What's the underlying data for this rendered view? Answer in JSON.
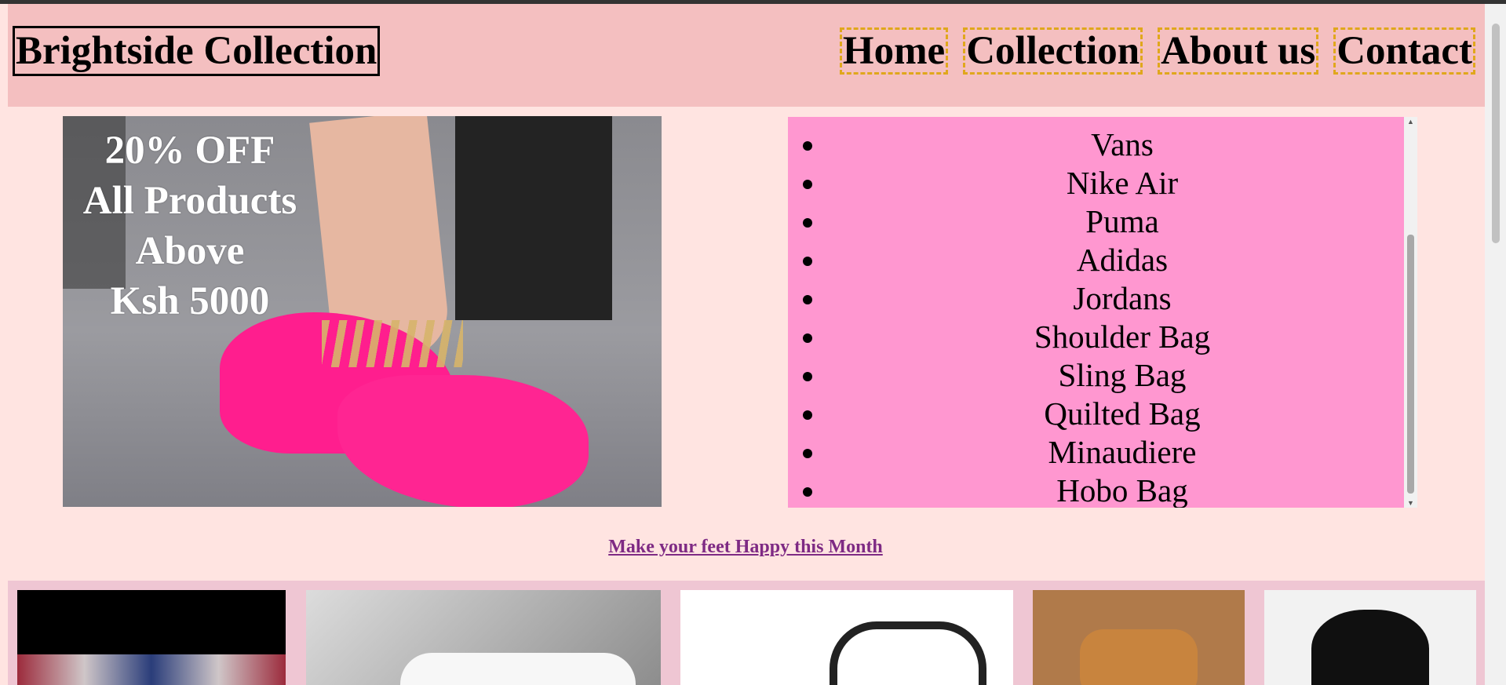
{
  "header": {
    "brand": "Brightside Collection",
    "nav": [
      "Home",
      "Collection",
      "About us",
      "Contact"
    ]
  },
  "hero": {
    "promo_lines": [
      "20% OFF",
      "All Products",
      "Above",
      "Ksh 5000"
    ]
  },
  "brand_list": {
    "items": [
      "Vans",
      "Nike Air",
      "Puma",
      "Adidas",
      "Jordans",
      "Shoulder Bag",
      "Sling Bag",
      "Quilted Bag",
      "Minaudiere",
      "Hobo Bag"
    ]
  },
  "tagline": "Make your feet Happy this Month",
  "colors": {
    "header_bg": "#f4bfc0",
    "page_bg": "#ffe4e1",
    "list_bg": "#ff97d0",
    "nav_border": "#e0a71c",
    "link": "#7e2a84"
  }
}
